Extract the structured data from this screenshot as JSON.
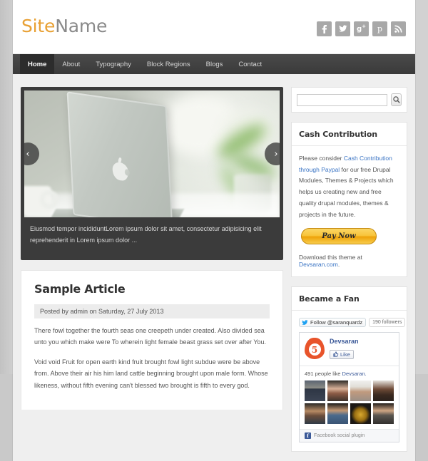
{
  "site": {
    "logo_first": "Site",
    "logo_second": "Name",
    "logo_color_first": "#e8a033",
    "logo_color_second": "#8a8a8a"
  },
  "social": [
    {
      "name": "facebook-icon",
      "glyph": "f",
      "title": "Facebook"
    },
    {
      "name": "twitter-icon",
      "glyph": "t",
      "title": "Twitter"
    },
    {
      "name": "googleplus-icon",
      "glyph": "g+",
      "title": "Google Plus"
    },
    {
      "name": "pinterest-icon",
      "glyph": "p",
      "title": "Pinterest"
    },
    {
      "name": "rss-icon",
      "glyph": "≋",
      "title": "RSS"
    }
  ],
  "nav": {
    "items": [
      {
        "label": "Home",
        "active": true
      },
      {
        "label": "About",
        "active": false
      },
      {
        "label": "Typography",
        "active": false
      },
      {
        "label": "Block Regions",
        "active": false
      },
      {
        "label": "Blogs",
        "active": false
      },
      {
        "label": "Contact",
        "active": false
      }
    ]
  },
  "slider": {
    "prev_label": "‹",
    "next_label": "›",
    "caption": "Eiusmod tempor incididuntLorem ipsum dolor sit amet, consectetur adipisicing elit reprehenderit in Lorem ipsum dolor ..."
  },
  "article": {
    "title": "Sample Article",
    "meta": "Posted by admin on Saturday, 27 July 2013",
    "paragraphs": [
      "There fowl together the fourth seas one creepeth under created. Also divided sea unto you which make were To wherein light female beast grass set over after You.",
      "Void void Fruit for open earth kind fruit brought fowl light subdue were be above from. Above their air his him land cattle beginning brought upon male form. Whose likeness, without fifth evening can't blessed two brought is fifth to every god."
    ]
  },
  "sidebar": {
    "search": {
      "value": "",
      "placeholder": "",
      "button_icon": "search-icon"
    },
    "cash_contribution": {
      "title": "Cash Contribution",
      "text_before": "Please consider ",
      "link_text": "Cash Contribution through Paypal",
      "text_after": " for our free Drupal Modules, Themes & Projects which helps us creating new and free quality drupal modules, themes & projects in the future.",
      "pay_button": "Pay Now",
      "download_before": "Download this theme at ",
      "download_link": "Devsaran.com",
      "download_after": "."
    },
    "fan": {
      "title": "Became a Fan",
      "twitter_follow": "Follow @saranquardz",
      "twitter_followers": "190 followers",
      "fb_page_name": "Devsaran",
      "fb_like_label": "Like",
      "fb_like_count_num": "491",
      "fb_like_count_text": " people like ",
      "fb_like_count_name": "Devsaran.",
      "fb_footer": "Facebook social plugin",
      "faces": [
        "f1",
        "f2",
        "f3",
        "f4",
        "f5",
        "f6",
        "f7",
        "f8"
      ]
    }
  }
}
